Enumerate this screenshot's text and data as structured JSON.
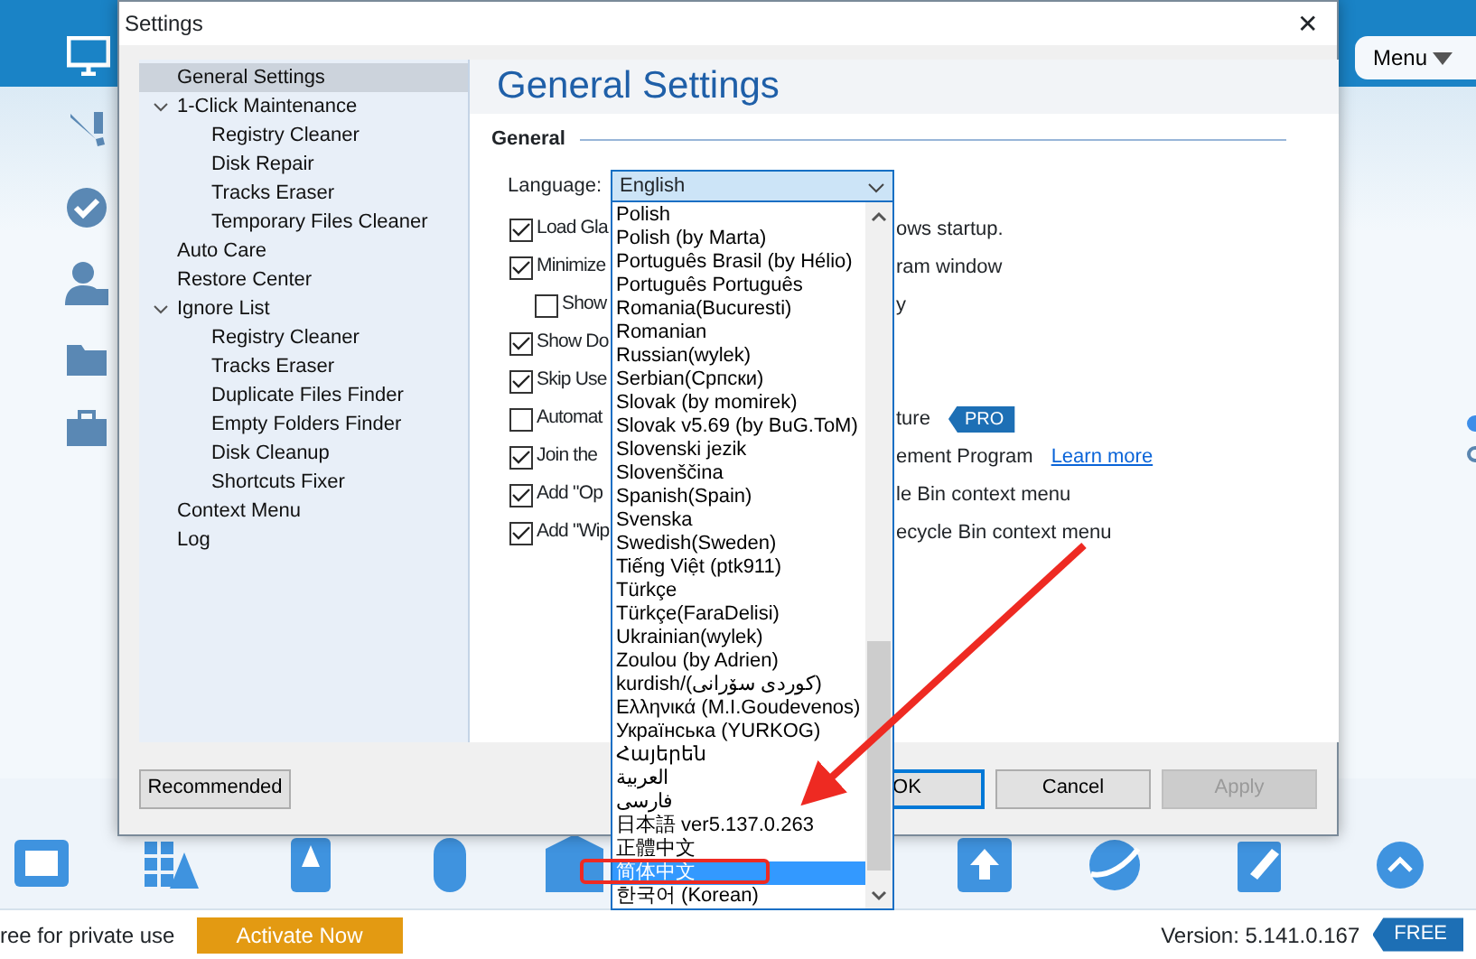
{
  "app": {
    "menu_button": "Menu",
    "page_dots": [
      {
        "selected": true
      },
      {
        "selected": false
      }
    ],
    "status": {
      "license_text": "ree for private use",
      "activate_button": "Activate Now",
      "version": "Version: 5.141.0.167",
      "badge": "FREE"
    }
  },
  "dialog": {
    "title": "Settings",
    "close": "✕",
    "nav": [
      {
        "label": "General Settings",
        "selected": true
      },
      {
        "label": "1-Click Maintenance",
        "selected": false,
        "expanded": true,
        "children": [
          {
            "label": "Registry Cleaner",
            "selected": false
          },
          {
            "label": "Disk Repair",
            "selected": false
          },
          {
            "label": "Tracks Eraser",
            "selected": false
          },
          {
            "label": "Temporary Files Cleaner",
            "selected": false
          }
        ]
      },
      {
        "label": "Auto Care",
        "selected": false
      },
      {
        "label": "Restore Center",
        "selected": false
      },
      {
        "label": "Ignore List",
        "selected": false,
        "expanded": true,
        "children": [
          {
            "label": "Registry Cleaner",
            "selected": false
          },
          {
            "label": "Tracks Eraser",
            "selected": false
          },
          {
            "label": "Duplicate Files Finder",
            "selected": false
          },
          {
            "label": "Empty Folders Finder",
            "selected": false
          },
          {
            "label": "Disk Cleanup",
            "selected": false
          },
          {
            "label": "Shortcuts Fixer",
            "selected": false
          }
        ]
      },
      {
        "label": "Context Menu",
        "selected": false
      },
      {
        "label": "Log",
        "selected": false
      }
    ],
    "heading": "General Settings",
    "group": "General",
    "language": {
      "label": "Language:",
      "value": "English",
      "options": [
        {
          "label": "Polish",
          "selected": false
        },
        {
          "label": "Polish (by Marta)",
          "selected": false
        },
        {
          "label": "Português Brasil (by Hélio)",
          "selected": false
        },
        {
          "label": "Português Português",
          "selected": false
        },
        {
          "label": "Romania(Bucuresti)",
          "selected": false
        },
        {
          "label": "Romanian",
          "selected": false
        },
        {
          "label": "Russian(wylek)",
          "selected": false
        },
        {
          "label": "Serbian(Српски)",
          "selected": false
        },
        {
          "label": "Slovak (by momirek)",
          "selected": false
        },
        {
          "label": "Slovak v5.69 (by BuG.ToM)",
          "selected": false
        },
        {
          "label": "Slovenski jezik",
          "selected": false
        },
        {
          "label": "Slovenščina",
          "selected": false
        },
        {
          "label": "Spanish(Spain)",
          "selected": false
        },
        {
          "label": "Svenska",
          "selected": false
        },
        {
          "label": "Swedish(Sweden)",
          "selected": false
        },
        {
          "label": "Tiếng Việt (ptk911)",
          "selected": false
        },
        {
          "label": "Türkçe",
          "selected": false
        },
        {
          "label": "Türkçe(FaraDelisi)",
          "selected": false
        },
        {
          "label": "Ukrainian(wylek)",
          "selected": false
        },
        {
          "label": "Zoulou (by Adrien)",
          "selected": false
        },
        {
          "label": "kurdish/(كوردی سۆرانی)",
          "selected": false
        },
        {
          "label": "Ελληνικά (M.I.Goudevenos)",
          "selected": false
        },
        {
          "label": "Українська (YURKOG)",
          "selected": false
        },
        {
          "label": "Հայերեն",
          "selected": false
        },
        {
          "label": "العربية",
          "selected": false
        },
        {
          "label": "فارسی",
          "selected": false
        },
        {
          "label": "日本語 ver5.137.0.263",
          "selected": false
        },
        {
          "label": "正體中文",
          "selected": false
        },
        {
          "label": "简体中文",
          "selected": true
        },
        {
          "label": "한국어 (Korean)",
          "selected": false
        }
      ]
    },
    "options": [
      {
        "kind": "main",
        "checked": true,
        "text_left": "Load Gla",
        "text_right": "ows startup."
      },
      {
        "kind": "main",
        "checked": true,
        "text_left": "Minimize",
        "text_right": "ram window"
      },
      {
        "kind": "sub",
        "checked": false,
        "text_left": "Show",
        "text_right": "y"
      },
      {
        "kind": "main",
        "checked": true,
        "text_left": "Show Do"
      },
      {
        "kind": "main",
        "checked": true,
        "text_left": "Skip Use"
      },
      {
        "kind": "main",
        "checked": false,
        "text_left": "Automat",
        "text_right": "ture",
        "badge": "PRO"
      },
      {
        "kind": "main",
        "checked": true,
        "text_left": "Join the",
        "text_right": "ement Program",
        "link": "Learn more"
      },
      {
        "kind": "main",
        "checked": true,
        "text_left": "Add \"Op",
        "text_right": "le Bin context menu"
      },
      {
        "kind": "main",
        "checked": true,
        "text_left": "Add \"Wip",
        "text_right": "ecycle Bin context menu"
      }
    ],
    "buttons": [
      {
        "label": "Recommended",
        "kind": "left",
        "disabled": false,
        "default": false
      },
      {
        "label": "OK",
        "kind": "right",
        "disabled": false,
        "default": true
      },
      {
        "label": "Cancel",
        "kind": "right",
        "disabled": false,
        "default": false
      },
      {
        "label": "Apply",
        "kind": "right",
        "disabled": true,
        "default": false
      }
    ]
  }
}
